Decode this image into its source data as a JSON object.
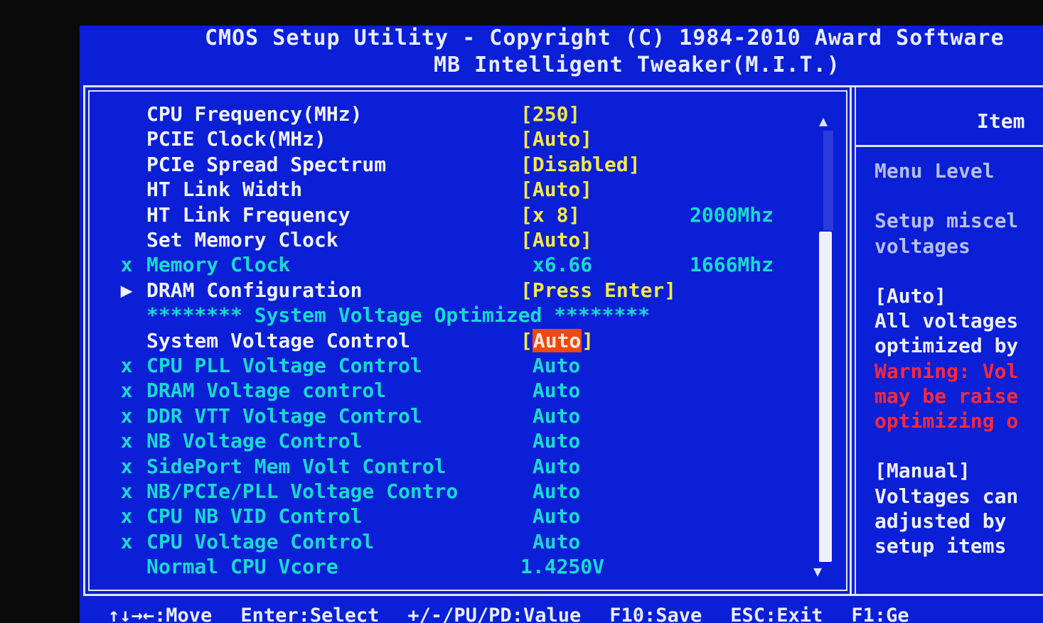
{
  "header": {
    "line1": "CMOS Setup Utility - Copyright (C) 1984-2010 Award Software",
    "line2": "MB Intelligent Tweaker(M.I.T.)"
  },
  "colors": {
    "background": "#0a1fd6",
    "label_active": "#f2f4ff",
    "value_active": "#f5e84a",
    "label_disabled": "#19d9d0",
    "highlight": "#f0480e",
    "warning": "#ff2a3a"
  },
  "rows": [
    {
      "marker": "",
      "label": "CPU Frequency(MHz)",
      "value": "[250]",
      "extra": "",
      "state": "active"
    },
    {
      "marker": "",
      "label": "PCIE Clock(MHz)",
      "value": "[Auto]",
      "extra": "",
      "state": "active"
    },
    {
      "marker": "",
      "label": "PCIe Spread Spectrum",
      "value": "[Disabled]",
      "extra": "",
      "state": "active"
    },
    {
      "marker": "",
      "label": "HT Link Width",
      "value": "[Auto]",
      "extra": "",
      "state": "active"
    },
    {
      "marker": "",
      "label": "HT Link Frequency",
      "value": "[x 8]",
      "extra": "2000Mhz",
      "state": "active"
    },
    {
      "marker": "",
      "label": "Set Memory Clock",
      "value": "[Auto]",
      "extra": "",
      "state": "active"
    },
    {
      "marker": "x",
      "label": "Memory Clock",
      "value": " x6.66",
      "extra": "1666Mhz",
      "state": "disabled"
    },
    {
      "marker": "▶",
      "label": "DRAM Configuration",
      "value": "[Press Enter]",
      "extra": "",
      "state": "submenu"
    },
    {
      "marker": "",
      "label": "******** System Voltage Optimized ********",
      "value": "",
      "extra": "",
      "state": "separator"
    },
    {
      "marker": "",
      "label": "System Voltage Control",
      "value": "Auto",
      "extra": "",
      "state": "selected"
    },
    {
      "marker": "x",
      "label": "CPU PLL Voltage Control",
      "value": " Auto",
      "extra": "",
      "state": "disabled"
    },
    {
      "marker": "x",
      "label": "DRAM Voltage control",
      "value": " Auto",
      "extra": "",
      "state": "disabled"
    },
    {
      "marker": "x",
      "label": "DDR VTT Voltage Control",
      "value": " Auto",
      "extra": "",
      "state": "disabled"
    },
    {
      "marker": "x",
      "label": "NB Voltage Control",
      "value": " Auto",
      "extra": "",
      "state": "disabled"
    },
    {
      "marker": "x",
      "label": "SidePort Mem Volt Control",
      "value": " Auto",
      "extra": "",
      "state": "disabled"
    },
    {
      "marker": "x",
      "label": "NB/PCIe/PLL Voltage Contro",
      "value": " Auto",
      "extra": "",
      "state": "disabled"
    },
    {
      "marker": "x",
      "label": "CPU NB VID Control",
      "value": " Auto",
      "extra": "",
      "state": "disabled"
    },
    {
      "marker": "x",
      "label": "CPU Voltage Control",
      "value": " Auto",
      "extra": "",
      "state": "disabled"
    },
    {
      "marker": "",
      "label": "Normal CPU Vcore",
      "value": "1.4250V",
      "extra": "",
      "state": "info"
    }
  ],
  "scrollbar": {
    "up": "▲",
    "down": "▼"
  },
  "help": {
    "title": "Item",
    "lines": [
      {
        "text": "Menu Level",
        "color": "gray"
      },
      {
        "text": "",
        "color": "gray"
      },
      {
        "text": "Setup miscel",
        "color": "gray"
      },
      {
        "text": "voltages",
        "color": "gray"
      },
      {
        "text": "",
        "color": "gray"
      },
      {
        "text": "[Auto]",
        "color": "white"
      },
      {
        "text": "All voltages",
        "color": "white"
      },
      {
        "text": "optimized by",
        "color": "white"
      },
      {
        "text": "Warning: Vol",
        "color": "red"
      },
      {
        "text": "may be raise",
        "color": "red"
      },
      {
        "text": "optimizing o",
        "color": "red"
      },
      {
        "text": "",
        "color": "white"
      },
      {
        "text": "[Manual]",
        "color": "white"
      },
      {
        "text": "Voltages can",
        "color": "white"
      },
      {
        "text": "adjusted by ",
        "color": "white"
      },
      {
        "text": "setup items",
        "color": "white"
      }
    ]
  },
  "footer": [
    "↑↓→←:Move",
    "Enter:Select",
    "+/-/PU/PD:Value",
    "F10:Save",
    "ESC:Exit",
    "F1:Ge"
  ]
}
